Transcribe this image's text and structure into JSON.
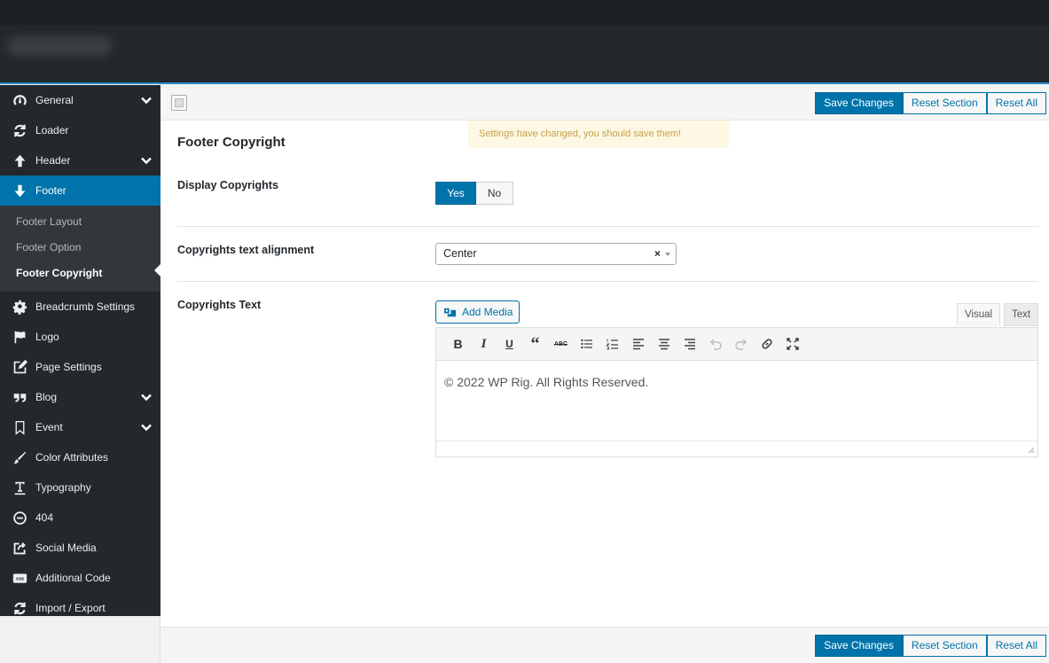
{
  "sidebar": {
    "items": [
      {
        "label": "General",
        "icon": "dashboard-icon",
        "chevron": true
      },
      {
        "label": "Loader",
        "icon": "refresh-icon",
        "chevron": false
      },
      {
        "label": "Header",
        "icon": "arrow-up-icon",
        "chevron": true
      },
      {
        "label": "Footer",
        "icon": "arrow-down-icon",
        "chevron": false,
        "active": true
      },
      {
        "label": "Breadcrumb Settings",
        "icon": "gear-icon"
      },
      {
        "label": "Logo",
        "icon": "flag-icon"
      },
      {
        "label": "Page Settings",
        "icon": "edit-icon"
      },
      {
        "label": "Blog",
        "icon": "quote-icon",
        "chevron": true
      },
      {
        "label": "Event",
        "icon": "bookmark-icon",
        "chevron": true
      },
      {
        "label": "Color Attributes",
        "icon": "brush-icon"
      },
      {
        "label": "Typography",
        "icon": "text-underline-icon"
      },
      {
        "label": "404",
        "icon": "minus-circle-icon"
      },
      {
        "label": "Social Media",
        "icon": "share-icon"
      },
      {
        "label": "Additional Code",
        "icon": "css-icon"
      },
      {
        "label": "Import / Export",
        "icon": "refresh-icon"
      }
    ],
    "footer_sub": [
      "Footer Layout",
      "Footer Option",
      "Footer Copyright"
    ]
  },
  "toolbar": {
    "save_label": "Save Changes",
    "reset_section_label": "Reset Section",
    "reset_all_label": "Reset All"
  },
  "notice": "Settings have changed, you should save them!",
  "section": {
    "title": "Footer Copyright",
    "display_copyrights": {
      "label": "Display Copyrights",
      "yes": "Yes",
      "no": "No",
      "selected": "Yes"
    },
    "alignment": {
      "label": "Copyrights text alignment",
      "value": "Center",
      "clear": "×"
    },
    "copyrights_text": {
      "label": "Copyrights Text",
      "add_media": "Add Media",
      "tab_visual": "Visual",
      "tab_text": "Text",
      "content": "© 2022 WP Rig. All Rights Reserved."
    }
  },
  "colors": {
    "accent": "#0073aa",
    "sidebar_bg": "#23282d",
    "notice_bg": "#fcf8e3"
  }
}
